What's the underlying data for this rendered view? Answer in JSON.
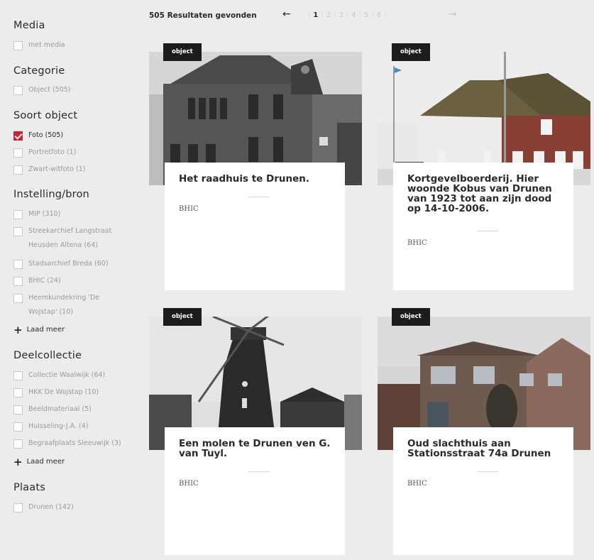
{
  "sidebar": {
    "media": {
      "title": "Media",
      "options": [
        {
          "label": "met media",
          "checked": false
        }
      ]
    },
    "categorie": {
      "title": "Categorie",
      "options": [
        {
          "label": "Object (505)",
          "checked": false
        }
      ]
    },
    "soort": {
      "title": "Soort object",
      "options": [
        {
          "label": "Foto (505)",
          "checked": true
        },
        {
          "label": "Portretfoto (1)",
          "checked": false
        },
        {
          "label": "Zwart-witfoto (1)",
          "checked": false
        }
      ]
    },
    "instelling": {
      "title": "Instelling/bron",
      "options": [
        {
          "label": "MIP (310)"
        },
        {
          "label_line1": "Streekarchief Langstraat",
          "label_line2": "Heusden Altena (64)"
        },
        {
          "label": "Stadsarchief Breda (60)"
        },
        {
          "label": "BHIC (24)"
        },
        {
          "label_line1": "Heemkundekring 'De",
          "label_line2": "Wojstap' (10)"
        }
      ],
      "more": "Laad meer"
    },
    "deelcollectie": {
      "title": "Deelcollectie",
      "options": [
        {
          "label": "Collectie Waalwijk (64)"
        },
        {
          "label": "HKK De Wojstap (10)"
        },
        {
          "label": "Beeldmateriaal (5)"
        },
        {
          "label": "Huisseling-J.A. (4)"
        },
        {
          "label": "Begraafplaats Sleeuwijk (3)"
        }
      ],
      "more": "Laad meer"
    },
    "plaats": {
      "title": "Plaats",
      "options": [
        {
          "label": "Drunen (142)"
        }
      ]
    }
  },
  "results": {
    "count_label": "505 Resultaten gevonden",
    "prev_icon": "←",
    "next_icon": "→",
    "pages": [
      "1",
      "2",
      "3",
      "4",
      "5",
      "6"
    ],
    "current_page": "1"
  },
  "cards": [
    {
      "tag": "object",
      "title": "Het raadhuis te Drunen.",
      "source": "BHIC"
    },
    {
      "tag": "object",
      "title": "Kortgevelboerderij. Hier woonde Kobus van Drunen van 1923 tot aan zijn dood op 14-10-2006.",
      "source": "BHIC"
    },
    {
      "tag": "object",
      "title": "Een molen te Drunen ven G. van Tuyl.",
      "source": "BHIC"
    },
    {
      "tag": "object",
      "title": "Oud slachthuis aan Stationsstraat 74a Drunen",
      "source": "BHIC"
    }
  ]
}
